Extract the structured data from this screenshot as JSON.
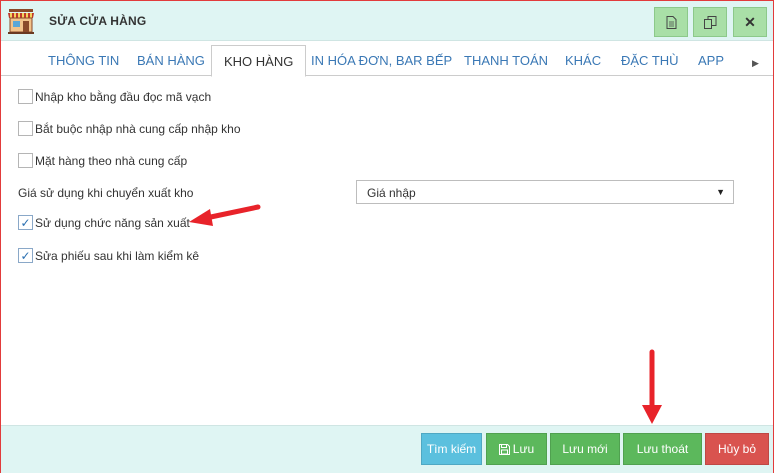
{
  "window": {
    "title": "SỬA CỬA HÀNG"
  },
  "titlebar_buttons": {
    "close_label": "✕"
  },
  "tabs": [
    {
      "label": "THÔNG TIN",
      "active": false
    },
    {
      "label": "BÁN HÀNG",
      "active": false
    },
    {
      "label": "KHO HÀNG",
      "active": true
    },
    {
      "label": "IN HÓA ĐƠN, BAR BẾP",
      "active": false
    },
    {
      "label": "THANH TOÁN",
      "active": false
    },
    {
      "label": "KHÁC",
      "active": false
    },
    {
      "label": "ĐẶC THÙ",
      "active": false
    },
    {
      "label": "APP",
      "active": false
    }
  ],
  "options": [
    {
      "label": "Nhập kho bằng đầu đọc mã vạch",
      "checked": false
    },
    {
      "label": "Bắt buộc nhập nhà cung cấp nhập kho",
      "checked": false
    },
    {
      "label": "Mặt hàng theo nhà cung cấp",
      "checked": false
    },
    {
      "label": "Sử dụng chức năng sản xuất",
      "checked": true
    },
    {
      "label": "Sửa phiếu sau khi làm kiểm kê",
      "checked": true
    }
  ],
  "price_field": {
    "label": "Giá sử dụng khi chuyển xuất kho",
    "value": "Giá nhập"
  },
  "footer": {
    "search_label": "Tìm kiếm",
    "save_label": "Lưu",
    "save_new_label": "Lưu mới",
    "save_exit_label": "Lưu thoát",
    "cancel_label": "Hủy bỏ"
  },
  "colors": {
    "header_bg": "#dff5f3",
    "tab_link": "#3a78b5",
    "btn_green": "#5cb85c",
    "btn_blue": "#5bc0de",
    "btn_red": "#d9534f",
    "annotation_red": "#e8232a"
  },
  "icons": {
    "app": "storefront-icon",
    "tb1": "document-icon",
    "tb2": "copy-icon",
    "tb3": "close-icon",
    "save": "floppy-disk-icon"
  }
}
